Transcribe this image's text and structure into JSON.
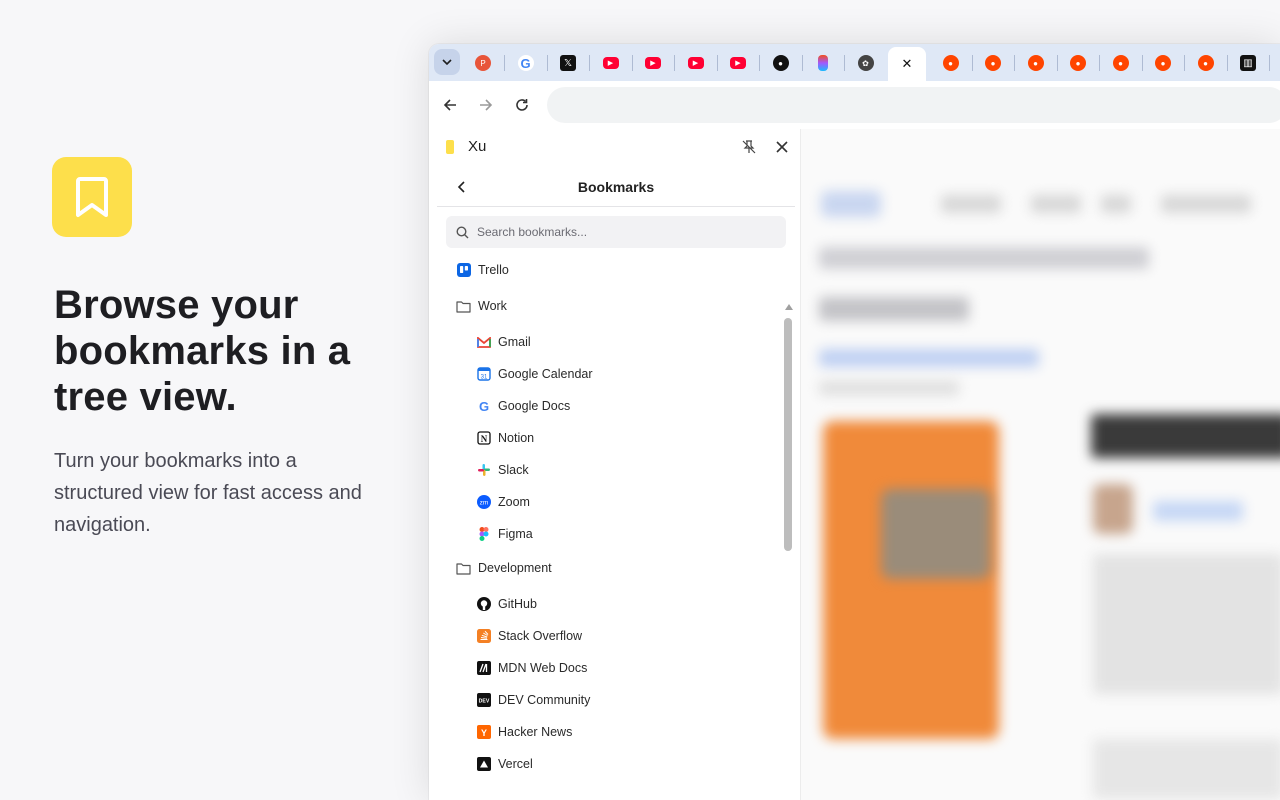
{
  "promo": {
    "icon": "bookmark-icon",
    "title": "Browse your bookmarks in a tree view.",
    "subtitle": "Turn your bookmarks into a structured view for fast access and navigation.",
    "accent_color": "#fddf4b"
  },
  "browser": {
    "tabs": [
      {
        "icon": "producthunt-icon",
        "color": "#e8553a",
        "letter": "P"
      },
      {
        "icon": "google-icon",
        "color": "#4285f4",
        "letter": "G"
      },
      {
        "icon": "x-icon",
        "color": "#111111",
        "letter": "𝕏"
      },
      {
        "icon": "youtube-icon",
        "color": "#ff0033",
        "letter": "▶"
      },
      {
        "icon": "youtube-icon",
        "color": "#ff0033",
        "letter": "▶"
      },
      {
        "icon": "youtube-icon",
        "color": "#ff0033",
        "letter": "▶"
      },
      {
        "icon": "youtube-icon",
        "color": "#ff0033",
        "letter": "▶"
      },
      {
        "icon": "github-icon",
        "color": "#111111",
        "letter": "●"
      },
      {
        "icon": "figma-icon",
        "color": "#a259ff",
        "letter": "◆"
      },
      {
        "icon": "openai-icon",
        "color": "#444444",
        "letter": "✿"
      },
      {
        "icon": "close-icon",
        "color": "#111111",
        "letter": "✕",
        "active": true
      },
      {
        "icon": "reddit-icon",
        "color": "#ff4500",
        "letter": "●"
      },
      {
        "icon": "reddit-icon",
        "color": "#ff4500",
        "letter": "●"
      },
      {
        "icon": "reddit-icon",
        "color": "#ff4500",
        "letter": "●"
      },
      {
        "icon": "reddit-icon",
        "color": "#ff4500",
        "letter": "●"
      },
      {
        "icon": "reddit-icon",
        "color": "#ff4500",
        "letter": "●"
      },
      {
        "icon": "reddit-icon",
        "color": "#ff4500",
        "letter": "●"
      },
      {
        "icon": "reddit-icon",
        "color": "#ff4500",
        "letter": "●"
      },
      {
        "icon": "trello-icon",
        "color": "#0c66e4",
        "letter": "▥"
      }
    ],
    "toolbar": {
      "back_icon": "arrow-left-icon",
      "forward_icon": "arrow-right-icon",
      "reload_icon": "reload-icon"
    }
  },
  "side_panel": {
    "profile_name": "Xu",
    "header_title": "Bookmarks",
    "search_placeholder": "Search bookmarks...",
    "tree": [
      {
        "type": "bookmark",
        "level": 0,
        "label": "Trello",
        "icon": "trello-icon",
        "color": "#0c66e4"
      },
      {
        "type": "folder",
        "level": 0,
        "label": "Work",
        "icon": "folder-icon",
        "color": "#555555"
      },
      {
        "type": "bookmark",
        "level": 1,
        "label": "Gmail",
        "icon": "gmail-icon",
        "color": "#ea4335"
      },
      {
        "type": "bookmark",
        "level": 1,
        "label": "Google Calendar",
        "icon": "google-calendar-icon",
        "color": "#1a73e8"
      },
      {
        "type": "bookmark",
        "level": 1,
        "label": "Google Docs",
        "icon": "google-icon",
        "color": "#4285f4"
      },
      {
        "type": "bookmark",
        "level": 1,
        "label": "Notion",
        "icon": "notion-icon",
        "color": "#111111"
      },
      {
        "type": "bookmark",
        "level": 1,
        "label": "Slack",
        "icon": "slack-icon",
        "color": "#4a154b"
      },
      {
        "type": "bookmark",
        "level": 1,
        "label": "Zoom",
        "icon": "zoom-icon",
        "color": "#0b5cff"
      },
      {
        "type": "bookmark",
        "level": 1,
        "label": "Figma",
        "icon": "figma-icon",
        "color": "#f24e1e"
      },
      {
        "type": "folder",
        "level": 0,
        "label": "Development",
        "icon": "folder-icon",
        "color": "#555555"
      },
      {
        "type": "bookmark",
        "level": 1,
        "label": "GitHub",
        "icon": "github-icon",
        "color": "#111111"
      },
      {
        "type": "bookmark",
        "level": 1,
        "label": "Stack Overflow",
        "icon": "stackoverflow-icon",
        "color": "#f48024"
      },
      {
        "type": "bookmark",
        "level": 1,
        "label": "MDN Web Docs",
        "icon": "mdn-icon",
        "color": "#111111"
      },
      {
        "type": "bookmark",
        "level": 1,
        "label": "DEV Community",
        "icon": "dev-icon",
        "color": "#111111"
      },
      {
        "type": "bookmark",
        "level": 1,
        "label": "Hacker News",
        "icon": "hackernews-icon",
        "color": "#ff6600"
      },
      {
        "type": "bookmark",
        "level": 1,
        "label": "Vercel",
        "icon": "vercel-icon",
        "color": "#111111"
      }
    ]
  }
}
